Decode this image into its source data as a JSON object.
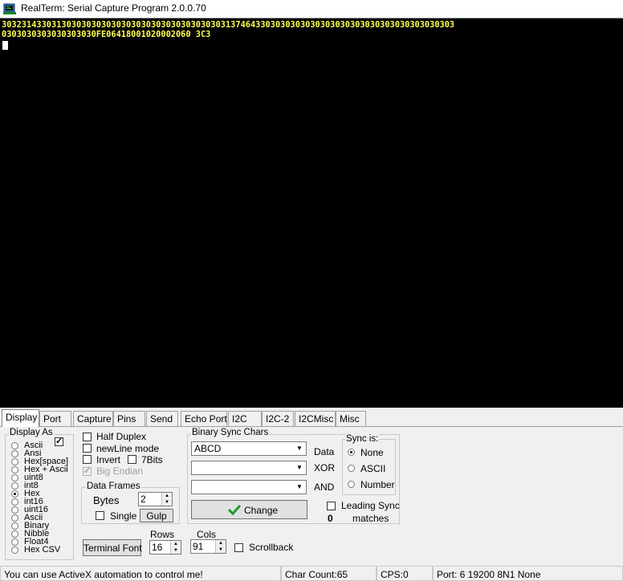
{
  "window": {
    "title": "RealTerm: Serial Capture Program 2.0.0.70"
  },
  "terminal": {
    "lines": [
      "3032314330313030303030303030303030303030303031374643303030303030303030303030303030303030303",
      "0303030303030303030FE06418001020002060 3C3"
    ]
  },
  "tabs": [
    "Display",
    "Port",
    "Capture",
    "Pins",
    "Send",
    "Echo Port",
    "I2C",
    "I2C-2",
    "I2CMisc",
    "Misc"
  ],
  "display_as": {
    "label": "Display As",
    "options": [
      "Ascii",
      "Ansi",
      "Hex[space]",
      "Hex + Ascii",
      "uint8",
      "int8",
      "Hex",
      "int16",
      "uint16",
      "Ascii",
      "Binary",
      "Nibble",
      "Float4",
      "Hex CSV"
    ],
    "selected": "Hex"
  },
  "options": {
    "half_duplex": "Half Duplex",
    "newline_mode": "newLine mode",
    "invert": "Invert",
    "seven_bits": "7Bits",
    "big_endian": "Big Endian"
  },
  "data_frames": {
    "label": "Data Frames",
    "bytes_label": "Bytes",
    "bytes_value": "2",
    "single_label": "Single",
    "gulp_label": "Gulp"
  },
  "binary_sync": {
    "label": "Binary Sync Chars",
    "data_value": "ABCD",
    "xor_value": "",
    "and_value": "",
    "data_label": "Data",
    "xor_label": "XOR",
    "and_label": "AND",
    "change_label": "Change",
    "leading_sync_label": "Leading Sync",
    "matches_label": "matches",
    "matches_count": "0"
  },
  "sync_is": {
    "label": "Sync is:",
    "options": [
      "None",
      "ASCII",
      "Number"
    ],
    "selected": "None"
  },
  "bottom": {
    "terminal_font_label": "Terminal Font",
    "rows_label": "Rows",
    "rows_value": "16",
    "cols_label": "Cols",
    "cols_value": "91",
    "scrollback_label": "Scrollback"
  },
  "status": {
    "message": "You can use ActiveX automation to control me!",
    "char_count": "Char Count:65",
    "cps": "CPS:0",
    "port": "Port: 6 19200 8N1 None"
  },
  "colors": {
    "terminal_bg": "#000000",
    "terminal_text": "#ffff55",
    "change_icon": "#1f9a2e"
  }
}
